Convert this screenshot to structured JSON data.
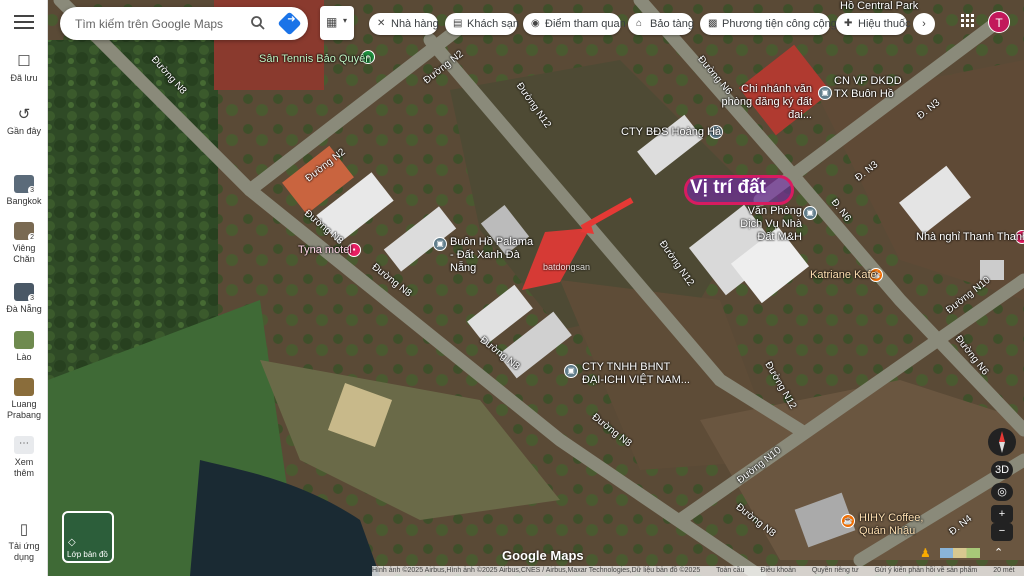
{
  "search": {
    "placeholder": "Tìm kiếm trên Google Maps"
  },
  "chips": [
    {
      "label": "Nhà hàng",
      "icon": "restaurant-icon"
    },
    {
      "label": "Khách sạn",
      "icon": "hotel-icon"
    },
    {
      "label": "Điểm tham quan",
      "icon": "camera-icon"
    },
    {
      "label": "Bảo tàng",
      "icon": "museum-icon"
    },
    {
      "label": "Phương tiện công cộng",
      "icon": "transit-icon"
    },
    {
      "label": "Hiệu thuốc",
      "icon": "pharmacy-icon"
    }
  ],
  "avatar": {
    "letter": "T",
    "color": "#c2185b"
  },
  "sidebar": {
    "saved": "Đã lưu",
    "recent": "Gần đây",
    "places": [
      {
        "label": "Bangkok",
        "badge": "3"
      },
      {
        "label": "Viêng Chăn",
        "badge": "2"
      },
      {
        "label": "Đà Nẵng",
        "badge": "3"
      },
      {
        "label": "Lào",
        "badge": ""
      },
      {
        "label": "Luang Prabang",
        "badge": ""
      }
    ],
    "more": "Xem thêm",
    "app": "Tải ứng dụng"
  },
  "map": {
    "highlight_label": "Vị trí đất",
    "streets": {
      "n8_top": "Đường N8",
      "n2_a": "Đường N2",
      "n2_b": "Đường N2",
      "n12_a": "Đường N12",
      "n8_left": "Đường N8",
      "n8_mid": "Đường N8",
      "n8_low": "Đường N8",
      "n8_low2": "Đường N8",
      "n8_bottom": "Đường N8",
      "n12_b": "Đường N12",
      "n12_c": "Đường N12",
      "n10_a": "Đường N10",
      "n10_b": "Đường N10",
      "n6_top": "Đường N6",
      "n6_mid": "Đ. N6",
      "n6_right": "Đường N6",
      "n3_a": "Đ. N3",
      "n3_b": "Đ. N3",
      "n4": "Đ. N4",
      "d_top": "Đ"
    },
    "pois": {
      "tennis": "Sân Tennis Bảo Quyên",
      "central_park": "Hồ Central Park",
      "chi_nhanh": "Chi nhánh văn phòng đăng ký đất đai...",
      "cn_vp": "CN VP DKDD TX Buôn Hồ",
      "bds": "CTY BĐS Hoàng Hà",
      "van_phong": "Văn Phòng Dịch Vụ Nhà Đất M&H",
      "nha_nghi": "Nhà nghỉ Thanh Thanh",
      "palama": "Buôn Hồ Palama - Đất Xanh Đà Nẵng",
      "tyna": "Tyna motel",
      "katriane": "Katriane Kafe",
      "cty_bhnt": "CTY TNHH BHNT ĐẠI-ICHI VIỆT NAM...",
      "hihy": "HIHY Coffee, Quán Nhậu"
    },
    "watermark": "batdongsan"
  },
  "layers_tile": {
    "label": "Lớp bản đồ"
  },
  "logo": "Google Maps",
  "attribution": [
    "Hình ảnh ©2025 Airbus,Hình ảnh ©2025 Airbus,CNES / Airbus,Maxar Technologies,Dữ liệu bản đồ ©2025",
    "Toàn cầu",
    "Điều khoản",
    "Quyền riêng tư",
    "Gửi ý kiến phản hồi về sản phẩm",
    "20 mét"
  ],
  "controls": {
    "three_d": "3D",
    "zoom_in": "+",
    "zoom_out": "−"
  }
}
